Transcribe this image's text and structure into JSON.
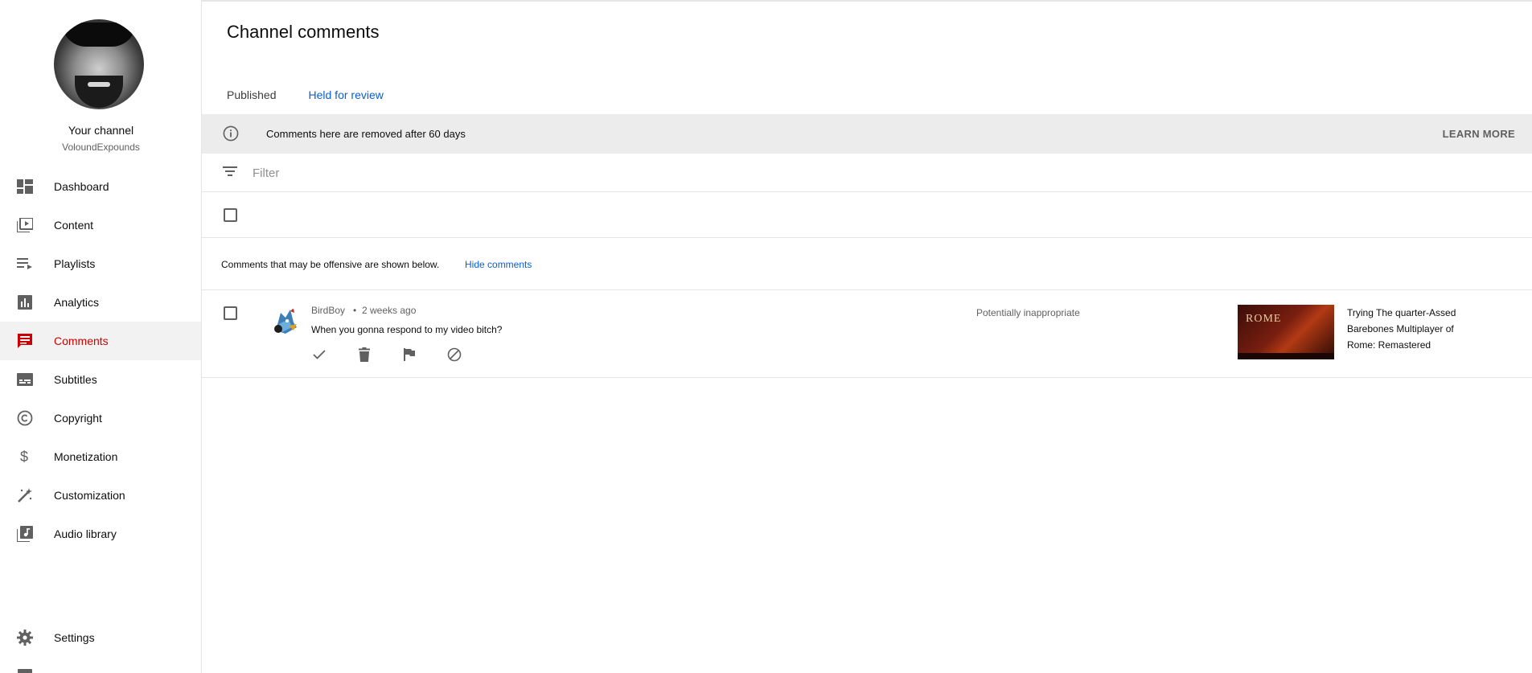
{
  "channel": {
    "title": "Your channel",
    "handle": "VoloundExpounds"
  },
  "nav": {
    "items": [
      {
        "label": "Dashboard",
        "icon": "dashboard-icon",
        "active": false
      },
      {
        "label": "Content",
        "icon": "content-icon",
        "active": false
      },
      {
        "label": "Playlists",
        "icon": "playlists-icon",
        "active": false
      },
      {
        "label": "Analytics",
        "icon": "analytics-icon",
        "active": false
      },
      {
        "label": "Comments",
        "icon": "comments-icon",
        "active": true
      },
      {
        "label": "Subtitles",
        "icon": "subtitles-icon",
        "active": false
      },
      {
        "label": "Copyright",
        "icon": "copyright-icon",
        "active": false
      },
      {
        "label": "Monetization",
        "icon": "monetization-icon",
        "active": false
      },
      {
        "label": "Customization",
        "icon": "customization-icon",
        "active": false
      },
      {
        "label": "Audio library",
        "icon": "audio-library-icon",
        "active": false
      }
    ],
    "settings": "Settings"
  },
  "page": {
    "title": "Channel comments",
    "tabs": [
      {
        "label": "Published",
        "selected": false
      },
      {
        "label": "Held for review",
        "selected": true
      }
    ]
  },
  "banner": {
    "text": "Comments here are removed after 60 days",
    "learn_more": "LEARN MORE"
  },
  "filter": {
    "placeholder": "Filter"
  },
  "notice": {
    "text": "Comments that may be offensive are shown below.",
    "hide_link": "Hide comments"
  },
  "comments": [
    {
      "author": "BirdBoy",
      "separator": "•",
      "time": "2 weeks ago",
      "text": "When you gonna respond to my video bitch?",
      "status": "Potentially inappropriate",
      "video_title": "Trying The quarter-Assed Barebones Multiplayer of Rome: Remastered",
      "thumbnail_text": "ROME"
    }
  ],
  "colors": {
    "accent": "#065fd4",
    "active_nav": "#cc0000",
    "banner_bg": "#ececec"
  }
}
